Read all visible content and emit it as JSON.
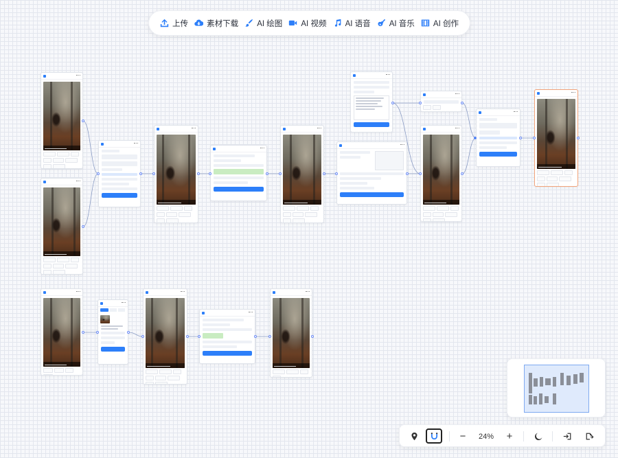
{
  "toolbar": {
    "items": [
      {
        "label": "上传",
        "icon": "upload-icon"
      },
      {
        "label": "素材下载",
        "icon": "cloud-download-icon"
      },
      {
        "label": "AI 绘图",
        "icon": "brush-icon"
      },
      {
        "label": "AI 视频",
        "icon": "video-camera-icon"
      },
      {
        "label": "AI 语音",
        "icon": "music-note-icon"
      },
      {
        "label": "AI 音乐",
        "icon": "guitar-icon"
      },
      {
        "label": "AI 创作",
        "icon": "film-icon"
      }
    ]
  },
  "controls": {
    "zoom_level": "24%",
    "zoom_out": "−",
    "zoom_in": "+",
    "icons": [
      "location-pin-icon",
      "magnet-icon",
      "moon-icon",
      "import-icon",
      "export-icon"
    ]
  },
  "colors": {
    "accent": "#2d7ff9",
    "selected_border": "#f2a37a",
    "wire": "#8a9cc4",
    "port": "#6c8cf5"
  }
}
